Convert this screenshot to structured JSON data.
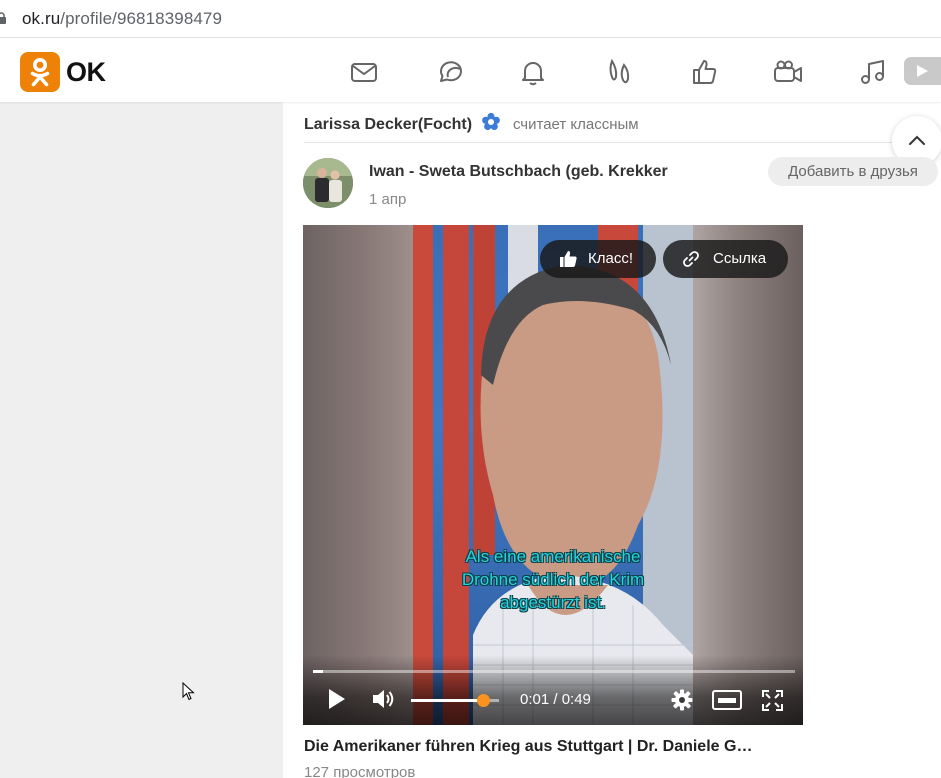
{
  "browser": {
    "url_host": "ok.ru",
    "url_path": "/profile/96818398479"
  },
  "header": {
    "logo_text": "OK",
    "brand_color": "#ee8208",
    "nav_icons": [
      "mail-icon",
      "chat-icon",
      "bell-icon",
      "guests-icon",
      "like-icon",
      "video-camera-icon",
      "music-icon",
      "video-icon"
    ]
  },
  "feed": {
    "liked_by": "Larissa Decker(Focht)",
    "liked_action": "считает классным",
    "post": {
      "author": "Iwan - Sweta Butschbach (geb. Krekker",
      "date": "1 апр",
      "add_friend_label": "Добавить в друзья",
      "video": {
        "klass_label": "Класс!",
        "link_label": "Ссылка",
        "subtitle_lines": [
          "Als eine amerikanische",
          "Drohne südlich der Krim",
          "abgestürzt ist."
        ],
        "time": "0:01 / 0:49",
        "progress": 0.02,
        "volume": 0.82
      },
      "title": "Die Amerikaner führen Krieg aus Stuttgart | Dr. Daniele G…",
      "views": "127 просмотров"
    }
  }
}
